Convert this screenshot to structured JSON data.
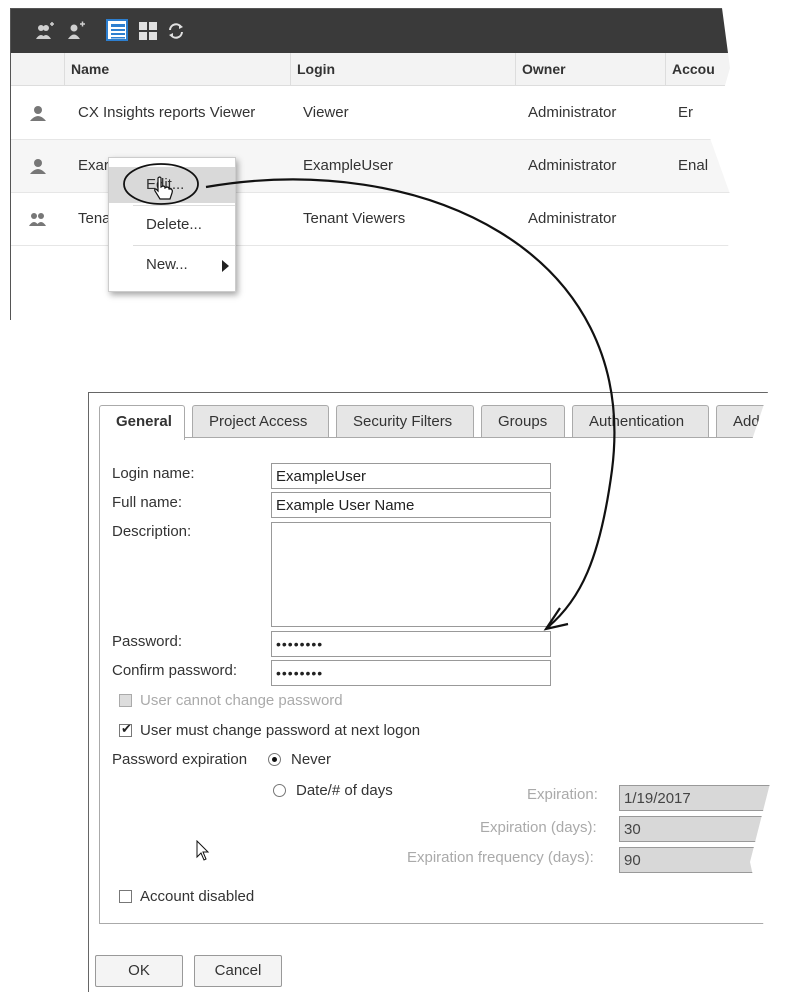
{
  "user_list": {
    "toolbar": {
      "icons": [
        "add-group-icon",
        "add-user-icon",
        "details-view-icon",
        "grid-view-icon",
        "refresh-icon"
      ]
    },
    "columns": [
      "Name",
      "Login",
      "Owner",
      "Accou"
    ],
    "rows": [
      {
        "icon": "user-icon",
        "name": "CX Insights reports Viewer",
        "login": "Viewer",
        "owner": "Administrator",
        "account": "Er"
      },
      {
        "icon": "user-icon",
        "name": "Exar",
        "login": "ExampleUser",
        "owner": "Administrator",
        "account": "Enal"
      },
      {
        "icon": "group-icon",
        "name": "Tena",
        "login": "Tenant Viewers",
        "owner": "Administrator",
        "account": ""
      }
    ],
    "context_menu": {
      "items": [
        "Edit...",
        "Delete...",
        "New..."
      ]
    }
  },
  "dialog": {
    "tabs": [
      "General",
      "Project Access",
      "Security Filters",
      "Groups",
      "Authentication",
      "Addi"
    ],
    "active_tab": "General",
    "labels": {
      "login_name": "Login name:",
      "full_name": "Full name:",
      "description": "Description:",
      "password": "Password:",
      "confirm_password": "Confirm password:",
      "cannot_change": "User cannot change password",
      "must_change": "User must change password at next logon",
      "password_expiration": "Password expiration",
      "never": "Never",
      "date_days": "Date/# of days",
      "expiration": "Expiration:",
      "expiration_days": "Expiration (days):",
      "expiration_frequency": "Expiration frequency (days):",
      "account_disabled": "Account disabled"
    },
    "values": {
      "login_name": "ExampleUser",
      "full_name": "Example User Name",
      "description": "",
      "password": "••••••••",
      "confirm_password": "••••••••",
      "expiration": "1/19/2017",
      "expiration_days": "30",
      "expiration_frequency": "90"
    },
    "state": {
      "cannot_change_checked": false,
      "must_change_checked": true,
      "password_expiration": "Never",
      "account_disabled": false
    },
    "buttons": {
      "ok": "OK",
      "cancel": "Cancel"
    }
  }
}
